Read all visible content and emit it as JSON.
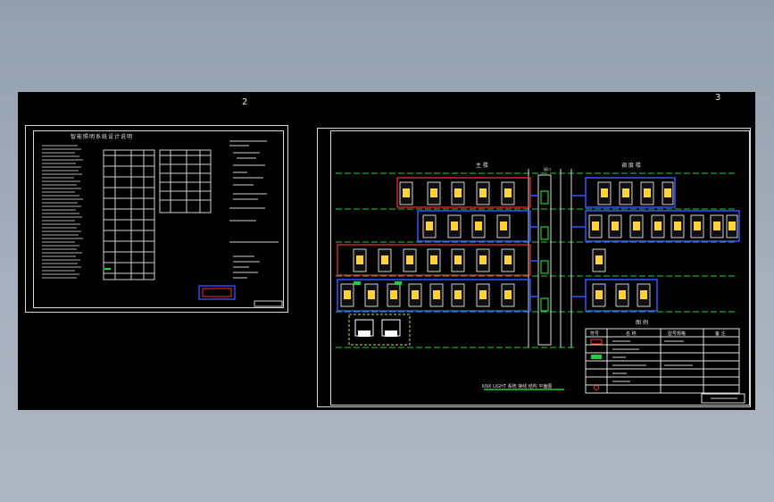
{
  "sheets": {
    "left": {
      "number": "2",
      "title": "智能照明系统设计说明"
    },
    "right": {
      "number": "3",
      "block_labels": {
        "main": "主 楼",
        "annex": "调 度 楼"
      },
      "mid_tag": "接口",
      "legend": {
        "title": "图 例",
        "headers": [
          "符号",
          "名 称",
          "型号规格",
          "备 注"
        ]
      },
      "drawing_title": "KNX LIGHT 系统 接线 结构 平面图"
    }
  }
}
